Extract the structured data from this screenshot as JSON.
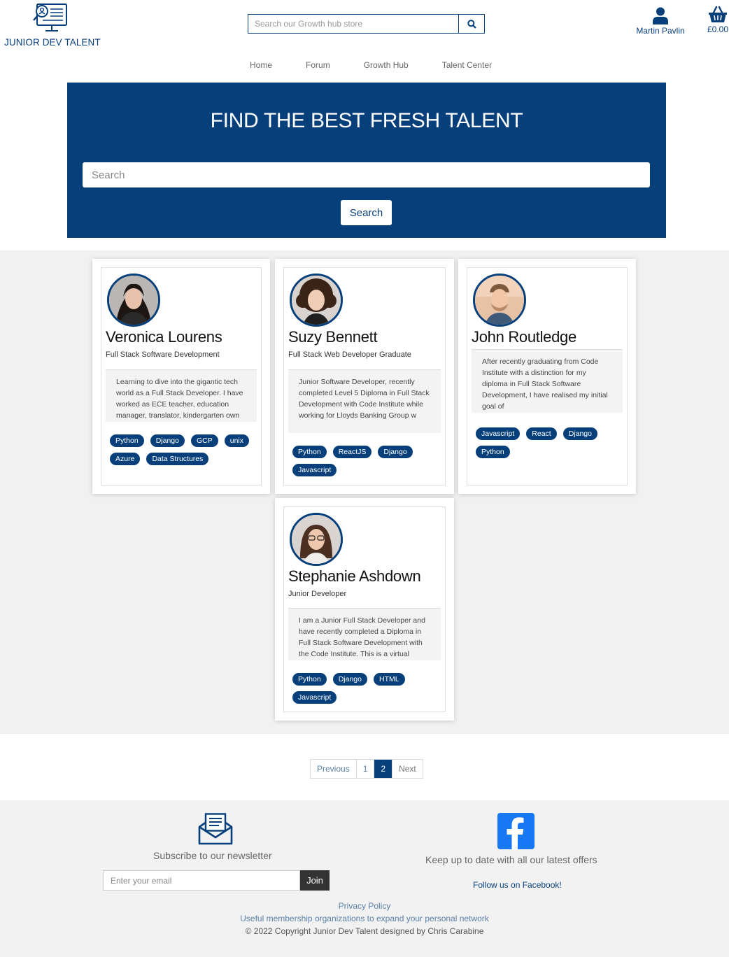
{
  "brand": {
    "logo_text": "JUNIOR DEV TALENT",
    "logo_icon": "monitor-magnifier-icon",
    "color": "#073f7b"
  },
  "header": {
    "store_search_placeholder": "Search our Growth hub store",
    "search_icon": "search-icon",
    "user_name": "Martin Pavlin",
    "user_icon": "user-icon",
    "basket_total": "£0.00",
    "basket_icon": "basket-icon"
  },
  "nav": [
    "Home",
    "Forum",
    "Growth Hub",
    "Talent Center"
  ],
  "hero": {
    "title": "FIND THE BEST FRESH TALENT",
    "search_placeholder": "Search",
    "button": "Search"
  },
  "candidates": [
    {
      "name": "Veronica Lourens",
      "role": "Full Stack Software Development",
      "bio": "Learning to dive into the gigantic tech world as a Full Stack Developer. I have worked as ECE teacher, education manager, translator, kindergarten own",
      "skills": [
        "Python",
        "Django",
        "GCP",
        "unix",
        "Azure",
        "Data Structures"
      ]
    },
    {
      "name": "Suzy Bennett",
      "role": "Full Stack Web Developer Graduate",
      "bio": "Junior Software Developer, recently completed Level 5 Diploma in Full Stack Development with Code Institute while working for Lloyds Banking Group w",
      "skills": [
        "Python",
        "ReactJS",
        "Django",
        "Javascript"
      ]
    },
    {
      "name": "John Routledge",
      "role": "",
      "bio": "After recently graduating from Code Institute with a distinction for my diploma in Full Stack Software Development, I have realised my initial goal of",
      "skills": [
        "Javascript",
        "React",
        "Django",
        "Python"
      ]
    },
    {
      "name": "Stephanie Ashdown",
      "role": "Junior Developer",
      "bio": "I am a Junior Full Stack Developer and have recently completed a Diploma in Full Stack Software Development with the Code Institute. This is a virtual",
      "skills": [
        "Python",
        "Django",
        "HTML",
        "Javascript"
      ]
    }
  ],
  "pagination": {
    "previous": "Previous",
    "pages": [
      "1",
      "2"
    ],
    "current": "2",
    "next": "Next"
  },
  "footer": {
    "newsletter_icon": "envelope-icon",
    "newsletter_text": "Subscribe to our newsletter",
    "email_placeholder": "Enter your email",
    "join": "Join",
    "facebook_icon": "facebook-icon",
    "facebook_text": "Keep up to date with all our latest offers",
    "facebook_link": "Follow us on Facebook!",
    "privacy": "Privacy Policy",
    "orgs": "Useful membership organizations to expand your personal network",
    "copyright": "© 2022 Copyright Junior Dev Talent designed by Chris Carabine"
  }
}
